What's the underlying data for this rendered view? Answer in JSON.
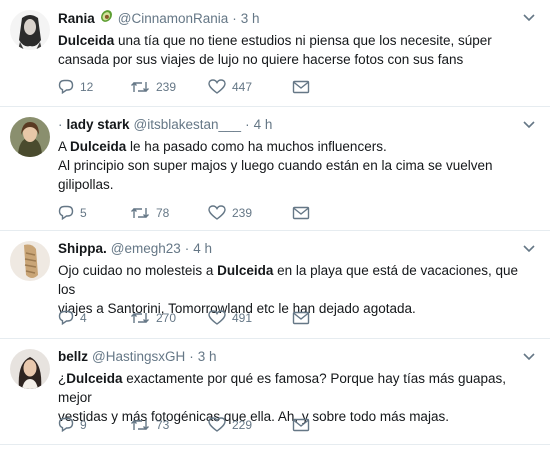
{
  "tweets": [
    {
      "name": "Rania",
      "handle": "@CinnamonRania",
      "time": "3 h",
      "text_lines": [
        {
          "before": "",
          "bold": "Dulceida",
          "after": " una tía que no tiene estudios ni piensa que los necesite, súper"
        },
        {
          "before": "cansada por sus viajes de lujo no quiere hacerse fotos con sus fans",
          "bold": "",
          "after": ""
        }
      ],
      "replies": "12",
      "retweets": "239",
      "likes": "447"
    },
    {
      "prefix": "·",
      "name": "lady stark",
      "handle": "@itsblakestan___",
      "time": "4 h",
      "text_lines": [
        {
          "before": "A ",
          "bold": "Dulceida",
          "after": " le ha pasado como ha muchos influencers."
        },
        {
          "before": "Al principio son super majos y luego cuando están en la cima se vuelven",
          "bold": "",
          "after": ""
        },
        {
          "before": "gilipollas.",
          "bold": "",
          "after": ""
        }
      ],
      "replies": "5",
      "retweets": "78",
      "likes": "239"
    },
    {
      "name": "Shippa.",
      "handle": "@emegh23",
      "time": "4 h",
      "text_lines": [
        {
          "before": "Ojo cuidao no molesteis a ",
          "bold": "Dulceida",
          "after": " en la playa que está de vacaciones, que los"
        },
        {
          "before": "viajes a Santorini, Tomorrowland etc le han dejado agotada.",
          "bold": "",
          "after": ""
        }
      ],
      "replies": "4",
      "retweets": "270",
      "likes": "491"
    },
    {
      "name": "bellz",
      "handle": "@HastingsxGH",
      "time": "3 h",
      "text_lines": [
        {
          "before": "¿",
          "bold": "Dulceida",
          "after": " exactamente por qué es famosa? Porque hay tías más guapas, mejor"
        },
        {
          "before": "vestidas y más fotogénicas que ella. Ah, y sobre todo más majas.",
          "bold": "",
          "after": ""
        }
      ],
      "replies": "9",
      "retweets": "73",
      "likes": "229"
    }
  ],
  "icons": {
    "reply": "reply-icon",
    "retweet": "retweet-icon",
    "like": "heart-icon",
    "message": "envelope-icon",
    "caret": "chevron-down-icon",
    "emoji": "avocado-icon"
  },
  "colors": {
    "text": "#14171a",
    "muted": "#657786",
    "divider": "#e6ecf0"
  }
}
